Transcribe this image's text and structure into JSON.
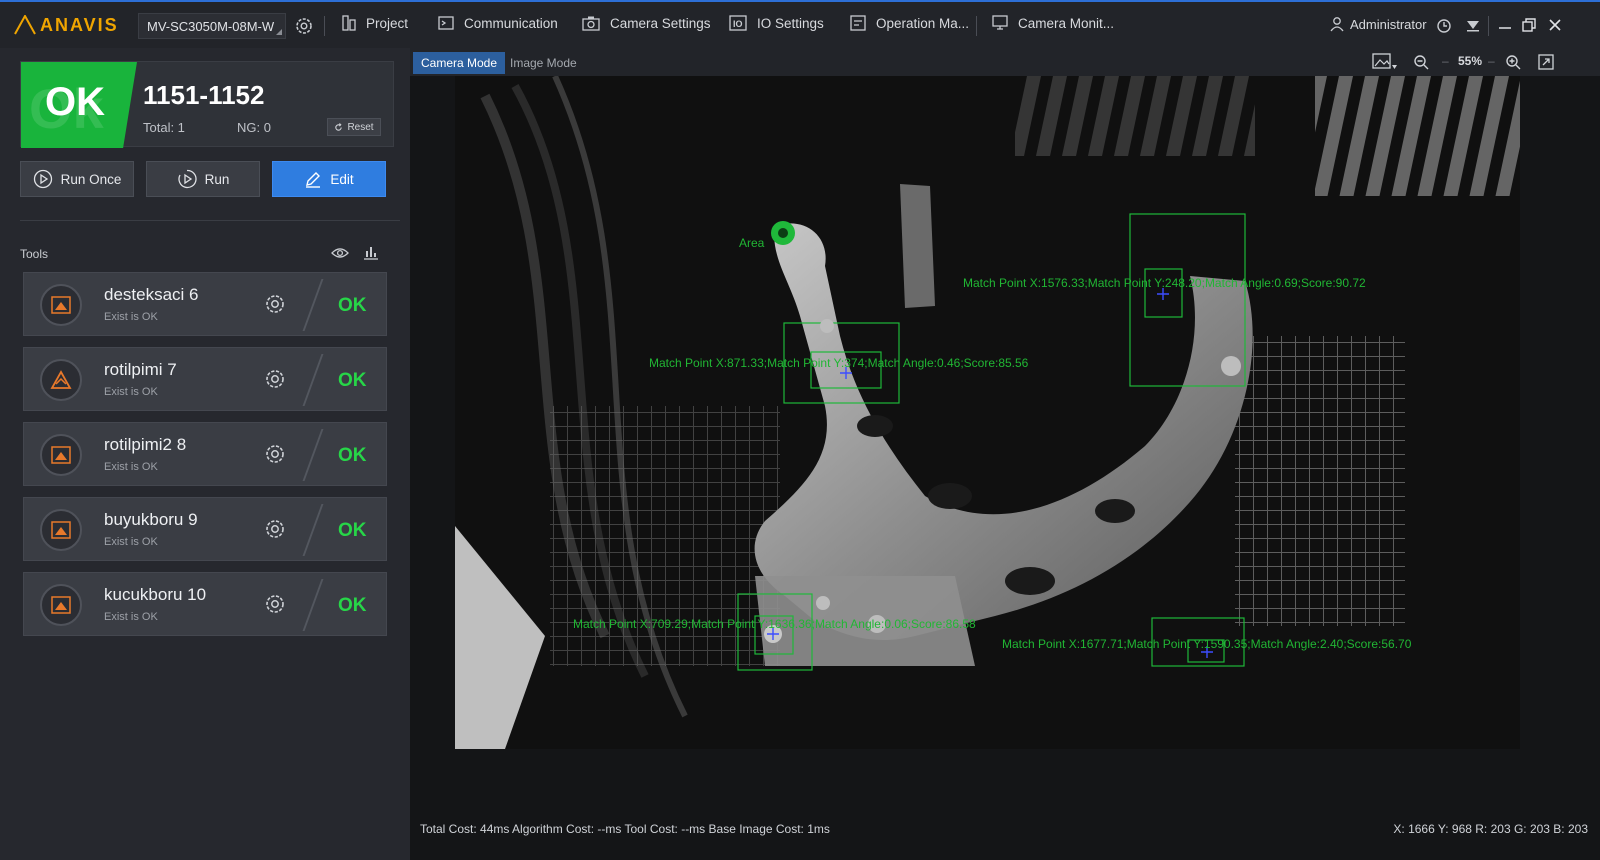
{
  "topbar": {
    "logo": "ANAVIS",
    "camera": "MV-SC3050M-08M-W",
    "menu": [
      "Project",
      "Communication",
      "Camera Settings",
      "IO Settings",
      "Operation Ma...",
      "Camera Monit..."
    ],
    "user": "Administrator"
  },
  "result": {
    "badge": "OK",
    "title": "1151-1152",
    "total": "Total: 1",
    "ng": "NG: 0",
    "reset": "Reset"
  },
  "buttons": {
    "run_once": "Run Once",
    "run": "Run",
    "edit": "Edit"
  },
  "tools": {
    "label": "Tools",
    "items": [
      {
        "name": "desteksaci 6",
        "status": "Exist is OK",
        "result": "OK",
        "icon": "image-icon"
      },
      {
        "name": "rotilpimi 7",
        "status": "Exist is OK",
        "result": "OK",
        "icon": "triangle-icon"
      },
      {
        "name": "rotilpimi2 8",
        "status": "Exist is OK",
        "result": "OK",
        "icon": "image-icon"
      },
      {
        "name": "buyukboru 9",
        "status": "Exist is OK",
        "result": "OK",
        "icon": "image-icon"
      },
      {
        "name": "kucukboru 10",
        "status": "Exist is OK",
        "result": "OK",
        "icon": "image-icon"
      }
    ]
  },
  "viewer": {
    "tabs": [
      "Camera Mode",
      "Image Mode"
    ],
    "zoom": "55%",
    "overlays": {
      "area": "Area",
      "m1": "Match Point X:1576.33;Match Point Y:248.20;Match Angle:0.69;Score:90.72",
      "m2": "Match Point X:871.33;Match Point Y:374;Match Angle:0.46;Score:85.56",
      "m3": "Match Point X:709.29;Match Point Y:1636.36;Match Angle:0.06;Score:86.58",
      "m4": "Match Point X:1677.71;Match Point Y:1590.35;Match Angle:2.40;Score:56.70"
    },
    "status": "Total Cost: 44ms   Algorithm Cost: --ms   Tool Cost: --ms   Base Image Cost: 1ms",
    "coords": "X: 1666 Y: 968    R: 203 G: 203 B: 203"
  },
  "colors": {
    "ok_green": "#19b43c",
    "accent_blue": "#2f7de0",
    "overlay_green": "#21b634",
    "logo": "#f0a500"
  }
}
